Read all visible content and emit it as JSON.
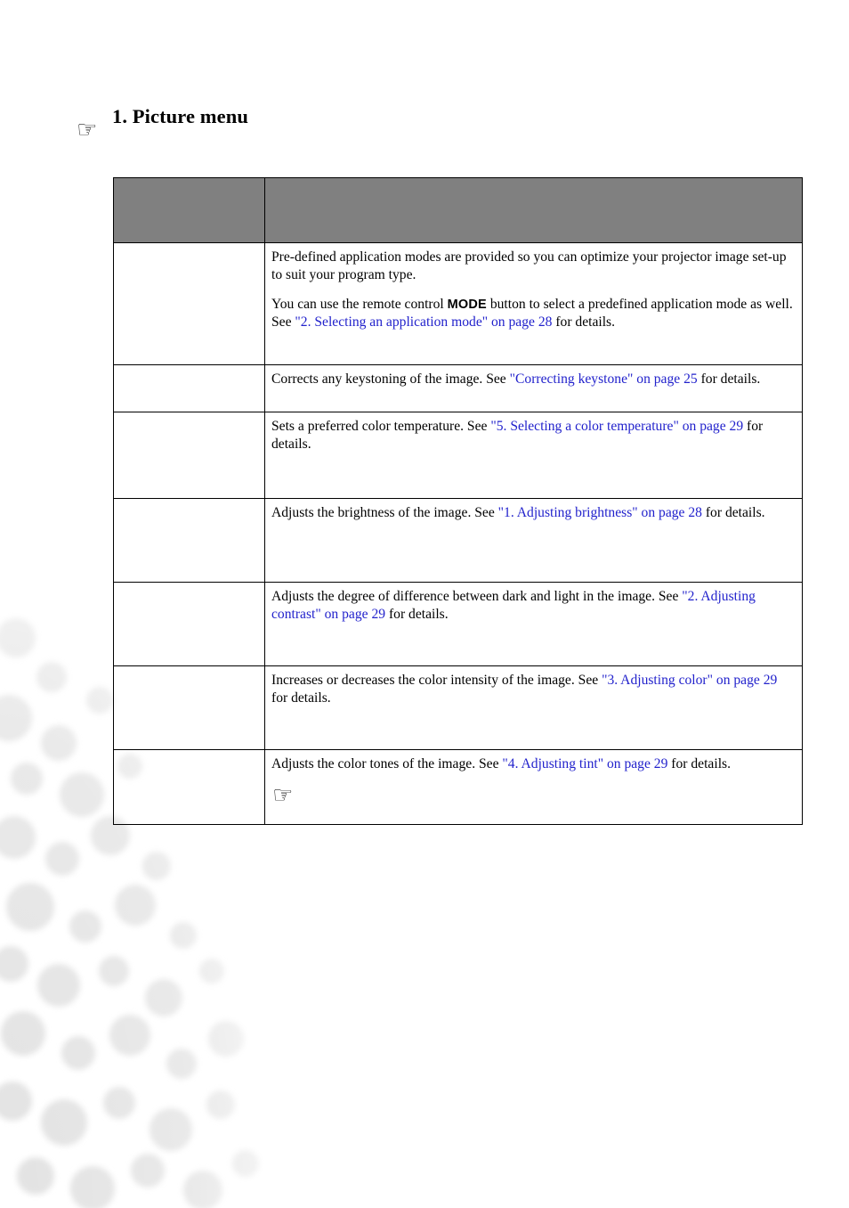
{
  "page": {
    "title": "1. Picture menu",
    "note_icon": "pointing-hand-icon"
  },
  "table": {
    "header": {
      "function_label": "",
      "description_label": ""
    },
    "rows": [
      {
        "name": "",
        "paragraphs": [
          {
            "parts": [
              {
                "type": "text",
                "value": "Pre-defined application modes are provided so you can optimize your projector image set-up to suit your program type."
              }
            ]
          },
          {
            "parts": [
              {
                "type": "text",
                "value": "You can use the remote control "
              },
              {
                "type": "kbd",
                "value": "MODE"
              },
              {
                "type": "text",
                "value": " button to select a predefined application mode as well. See "
              },
              {
                "type": "link",
                "value": "\"2. Selecting an application mode\" on page 28"
              },
              {
                "type": "text",
                "value": " for details."
              }
            ]
          }
        ],
        "hand": false
      },
      {
        "name": "",
        "paragraphs": [
          {
            "parts": [
              {
                "type": "text",
                "value": "Corrects any keystoning of the image. See "
              },
              {
                "type": "link",
                "value": "\"Correcting keystone\" on page 25"
              },
              {
                "type": "text",
                "value": " for details."
              }
            ]
          }
        ],
        "hand": false
      },
      {
        "name": "",
        "paragraphs": [
          {
            "parts": [
              {
                "type": "text",
                "value": "Sets a preferred color temperature. See "
              },
              {
                "type": "link",
                "value": "\"5. Selecting a color temperature\" on page 29"
              },
              {
                "type": "text",
                "value": " for details."
              }
            ]
          }
        ],
        "hand": false
      },
      {
        "name": "",
        "paragraphs": [
          {
            "parts": [
              {
                "type": "text",
                "value": "Adjusts the brightness of the image. See "
              },
              {
                "type": "link",
                "value": "\"1. Adjusting brightness\" on page 28"
              },
              {
                "type": "text",
                "value": " for details."
              }
            ]
          }
        ],
        "hand": false
      },
      {
        "name": "",
        "paragraphs": [
          {
            "parts": [
              {
                "type": "text",
                "value": "Adjusts the degree of difference between dark and light in the image. See "
              },
              {
                "type": "link",
                "value": "\"2. Adjusting contrast\" on page 29"
              },
              {
                "type": "text",
                "value": " for details."
              }
            ]
          }
        ],
        "hand": false
      },
      {
        "name": "",
        "paragraphs": [
          {
            "parts": [
              {
                "type": "text",
                "value": "Increases or decreases the color intensity of the image. See "
              },
              {
                "type": "link",
                "value": "\"3. Adjusting color\" on page 29"
              },
              {
                "type": "text",
                "value": " for details."
              }
            ]
          }
        ],
        "hand": false
      },
      {
        "name": "",
        "paragraphs": [
          {
            "parts": [
              {
                "type": "text",
                "value": "Adjusts the color tones of the image. See "
              },
              {
                "type": "link",
                "value": "\"4. Adjusting tint\" on page 29"
              },
              {
                "type": "text",
                "value": " for details."
              }
            ]
          }
        ],
        "hand": true
      }
    ]
  },
  "colors": {
    "header_background": "#808080",
    "link": "#2222cc",
    "text": "#000000",
    "page_background": "#ffffff",
    "watermark": "#e8e8e8"
  },
  "icons": {
    "pointing_hand": "☞"
  }
}
